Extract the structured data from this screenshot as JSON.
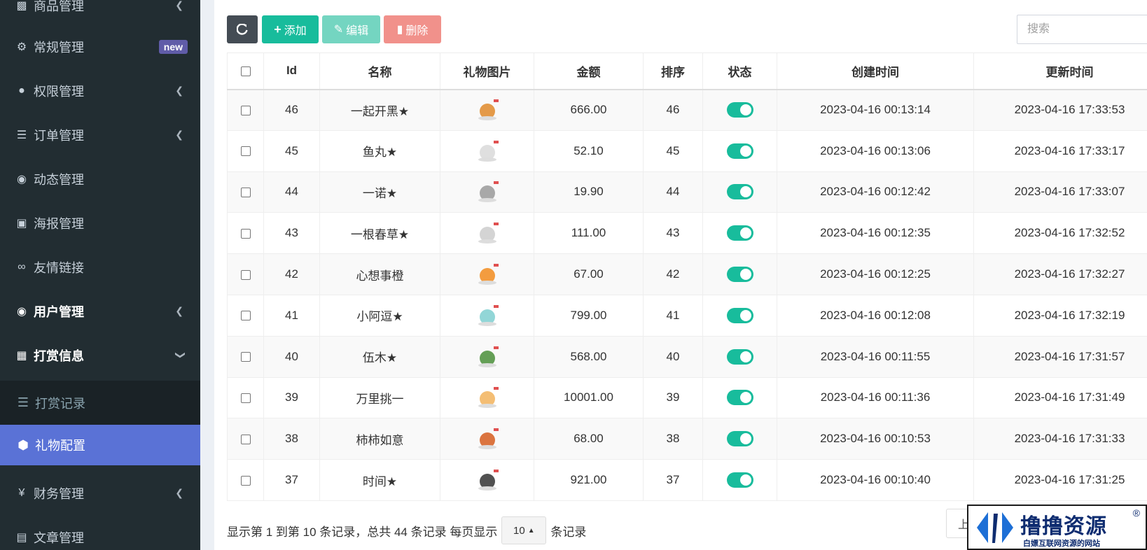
{
  "sidebar": {
    "items": [
      {
        "label": "商品管理",
        "icon": "book-icon"
      },
      {
        "label": "常规管理",
        "icon": "cogs-icon",
        "badge": "new"
      },
      {
        "label": "权限管理",
        "icon": "users-icon"
      },
      {
        "label": "订单管理",
        "icon": "list-icon"
      },
      {
        "label": "动态管理",
        "icon": "tripadvisor-icon"
      },
      {
        "label": "海报管理",
        "icon": "image-icon"
      },
      {
        "label": "友情链接",
        "icon": "link-icon"
      },
      {
        "label": "用户管理",
        "icon": "user-circle-icon"
      },
      {
        "label": "打赏信息",
        "icon": "gift-icon"
      },
      {
        "label": "财务管理",
        "icon": "yen-icon"
      },
      {
        "label": "文章管理",
        "icon": "file-icon"
      }
    ],
    "sub_item": {
      "label": "打赏记录",
      "icon": "bars-icon"
    },
    "active_item": {
      "label": "礼物配置",
      "icon": "cube-icon"
    }
  },
  "toolbar": {
    "add_label": "添加",
    "edit_label": "编辑",
    "delete_label": "删除",
    "search_placeholder": "搜索"
  },
  "table": {
    "headers": [
      "Id",
      "名称",
      "礼物图片",
      "金额",
      "排序",
      "状态",
      "创建时间",
      "更新时间"
    ],
    "rows": [
      {
        "id": "46",
        "name": "一起开黑★",
        "amount": "666.00",
        "sort": "46",
        "created": "2023-04-16 00:13:14",
        "updated": "2023-04-16 17:33:53"
      },
      {
        "id": "45",
        "name": "鱼丸★",
        "amount": "52.10",
        "sort": "45",
        "created": "2023-04-16 00:13:06",
        "updated": "2023-04-16 17:33:17"
      },
      {
        "id": "44",
        "name": "一诺★",
        "amount": "19.90",
        "sort": "44",
        "created": "2023-04-16 00:12:42",
        "updated": "2023-04-16 17:33:07"
      },
      {
        "id": "43",
        "name": "一根春草★",
        "amount": "111.00",
        "sort": "43",
        "created": "2023-04-16 00:12:35",
        "updated": "2023-04-16 17:32:52"
      },
      {
        "id": "42",
        "name": "心想事橙",
        "amount": "67.00",
        "sort": "42",
        "created": "2023-04-16 00:12:25",
        "updated": "2023-04-16 17:32:27"
      },
      {
        "id": "41",
        "name": "小阿逗★",
        "amount": "799.00",
        "sort": "41",
        "created": "2023-04-16 00:12:08",
        "updated": "2023-04-16 17:32:19"
      },
      {
        "id": "40",
        "name": "伍木★",
        "amount": "568.00",
        "sort": "40",
        "created": "2023-04-16 00:11:55",
        "updated": "2023-04-16 17:31:57"
      },
      {
        "id": "39",
        "name": "万里挑一",
        "amount": "10001.00",
        "sort": "39",
        "created": "2023-04-16 00:11:36",
        "updated": "2023-04-16 17:31:49"
      },
      {
        "id": "38",
        "name": "柿柿如意",
        "amount": "68.00",
        "sort": "38",
        "created": "2023-04-16 00:10:53",
        "updated": "2023-04-16 17:31:33"
      },
      {
        "id": "37",
        "name": "时间★",
        "amount": "921.00",
        "sort": "37",
        "created": "2023-04-16 00:10:40",
        "updated": "2023-04-16 17:31:25"
      }
    ]
  },
  "footer": {
    "summary": "显示第 1 到第 10 条记录，总共 44 条记录 每页显示",
    "page_size": "10",
    "suffix": "条记录",
    "prev_label": "上"
  },
  "watermark": {
    "title": "撸撸资源",
    "subtitle": "白嫖互联网资源的网站",
    "reg": "®"
  },
  "colors": {
    "sidebar_bg": "#222d32",
    "active_bg": "#5a72d6",
    "accent": "#18bc9c",
    "badge": "#605ca8"
  }
}
